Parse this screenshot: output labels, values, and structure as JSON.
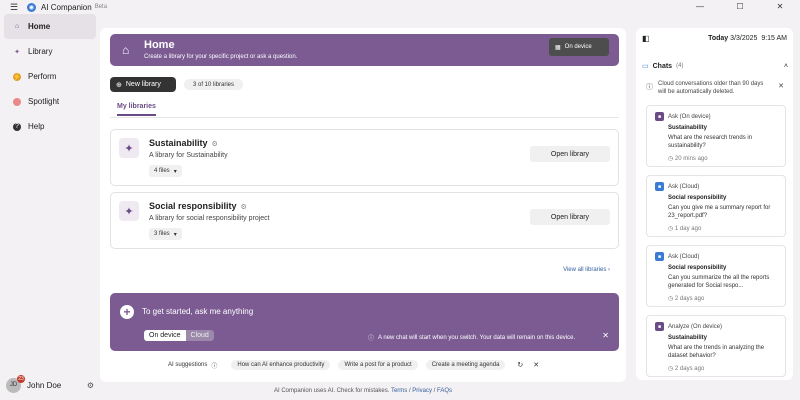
{
  "app": {
    "name": "AI Companion",
    "beta": "Beta"
  },
  "window": {
    "minimize": "—",
    "maximize": "☐",
    "close": "✕"
  },
  "sidebar": {
    "items": [
      {
        "label": "Home",
        "icon": "home-icon",
        "active": true
      },
      {
        "label": "Library",
        "icon": "sparkle-icon",
        "active": false
      },
      {
        "label": "Perform",
        "icon": "bolt-icon",
        "active": false
      },
      {
        "label": "Spotlight",
        "icon": "spotlight-icon",
        "active": false
      },
      {
        "label": "Help",
        "icon": "help-icon",
        "active": false
      }
    ],
    "user": {
      "initials": "JD",
      "badge": "23",
      "name": "John Doe"
    }
  },
  "home": {
    "title": "Home",
    "subtitle": "Create a library for your specific project or ask a question.",
    "device_label": "On device",
    "new_library": "New library",
    "library_count": "3 of 10 libraries",
    "tab": "My libraries",
    "libraries": [
      {
        "title": "Sustainability",
        "desc": "A library for Sustainability",
        "files": "4 files",
        "open": "Open library"
      },
      {
        "title": "Social responsibility",
        "desc": "A library for social responsibility project",
        "files": "3 files",
        "open": "Open library"
      }
    ],
    "view_all": "View all libraries",
    "ask": {
      "placeholder": "To get started, ask me anything",
      "toggle_on": "On device",
      "toggle_off": "Cloud",
      "note": "A new chat will start when you switch. Your data will remain on this device."
    },
    "suggestions": {
      "label": "AI suggestions",
      "chips": [
        "How can AI enhance productivity",
        "Write a post for a product",
        "Create a meeting agenda"
      ]
    },
    "footer": {
      "text": "AI Companion uses AI. Check for mistakes.",
      "terms": "Terms",
      "privacy": "Privacy",
      "faqs": "FAQs"
    }
  },
  "right": {
    "date_label": "Today",
    "date": "3/3/2025",
    "time": "9:15 AM",
    "chats_label": "Chats",
    "chats_count": "(4)",
    "notice": "Cloud conversations older than 90 days will be automatically deleted.",
    "chats": [
      {
        "type": "Ask (On device)",
        "library": "Sustainability",
        "question": "What are the research trends in sustainability?",
        "time": "20 mins ago",
        "color": "#6a4b85"
      },
      {
        "type": "Ask (Cloud)",
        "library": "Social responsibility",
        "question": "Can you give me a summary report for 23_report.pdf?",
        "time": "1 day ago",
        "color": "#3a7bd5"
      },
      {
        "type": "Ask (Cloud)",
        "library": "Social responsibility",
        "question": "Can you summarize the all the reports generated for Social respo...",
        "time": "2 days ago",
        "color": "#3a7bd5"
      },
      {
        "type": "Analyze (On device)",
        "library": "Sustainability",
        "question": "What are the trends in analyzing the dataset behavior?",
        "time": "2 days ago",
        "color": "#6a4b85"
      }
    ]
  }
}
